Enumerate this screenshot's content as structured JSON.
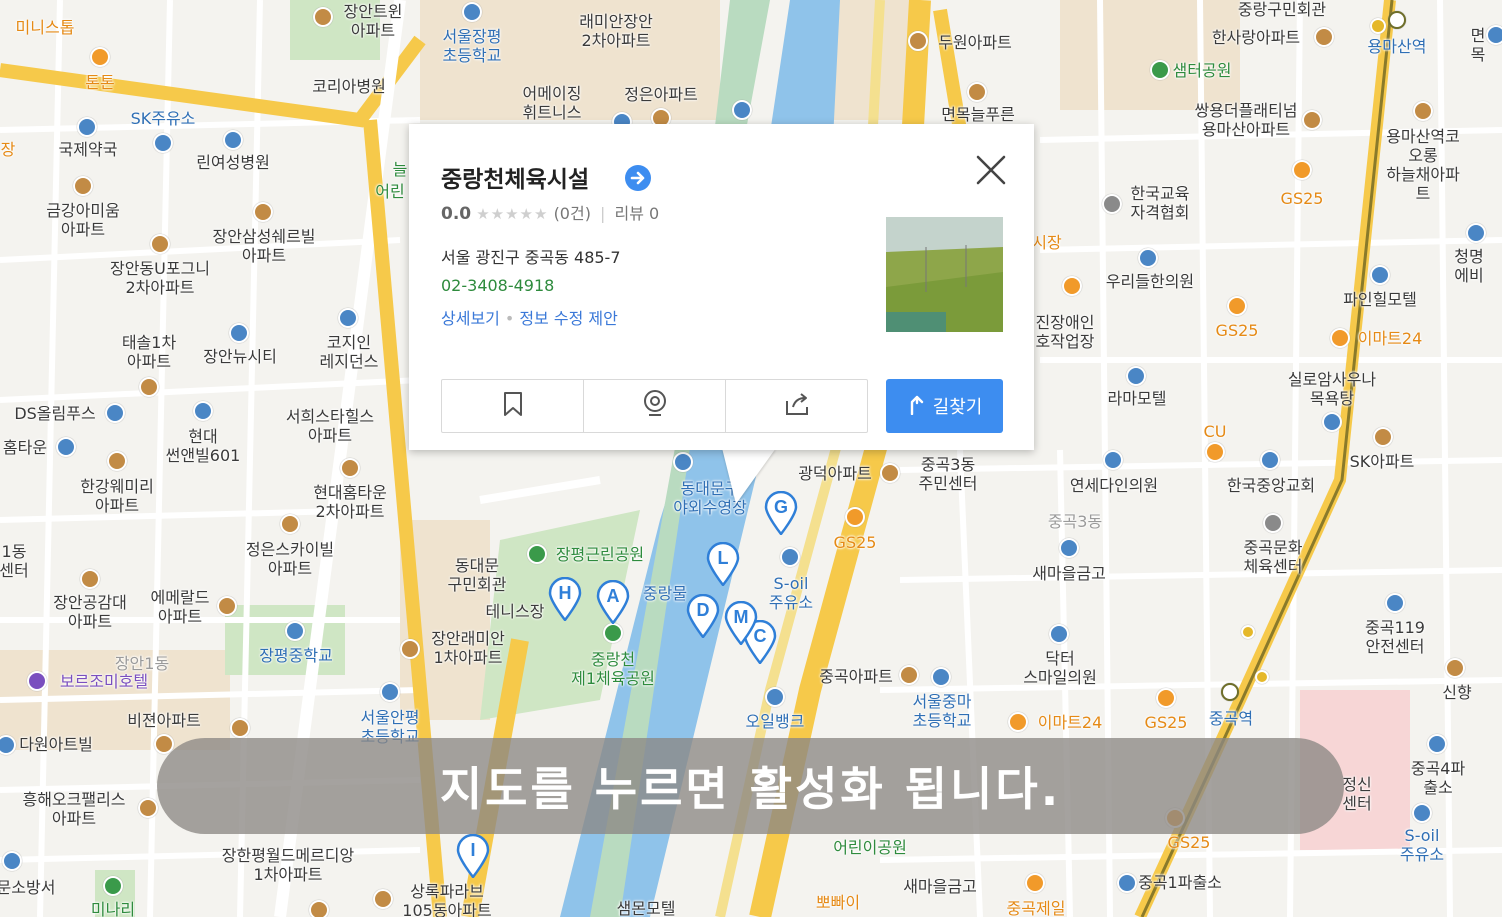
{
  "popup": {
    "place_name": "중랑천체육시설",
    "rating_score": "0.0",
    "stars": "★★★★★",
    "review_count": "(0건)",
    "review_label": "리뷰 0",
    "address": "서울 광진구 중곡동 485-7",
    "phone": "02-3408-4918",
    "detail_link": "상세보기",
    "edit_link": "정보 수정 제안",
    "route_button": "길찾기",
    "actions": [
      "bookmark-icon",
      "location-pin-icon",
      "share-icon"
    ]
  },
  "toast": {
    "message": "지도를 누르면 활성화 됩니다."
  },
  "markers": [
    "A",
    "C",
    "D",
    "G",
    "H",
    "I",
    "L",
    "M"
  ],
  "colors": {
    "accent": "#3d8df0",
    "phone": "#2e8b3d",
    "link": "#3a78d8",
    "road_major": "#f6c94a",
    "water": "#8fc3ea",
    "park": "#cfe6c4"
  },
  "map_labels": {
    "l1": "미니스톱",
    "l2": "장안트윈\n아파트",
    "l3": "서울장평\n초등학교",
    "l4": "래미안장안\n2차아파트",
    "l5": "두원아파트",
    "l6": "중랑구민회관",
    "l7": "한사랑아파트",
    "l8": "면목",
    "l9": "용마산역",
    "l10": "톤톤",
    "l11": "코리아병원",
    "l12": "샘터공원",
    "l13": "SK주유소",
    "l14": "어메이징\n휘트니스",
    "l15": "정은아파트",
    "l16": "면목늘푸른",
    "l17": "쌍용더플래티넘\n용마산아파트",
    "l18": "용마산역코오롱\n하늘채아파트",
    "l19": "국제약국",
    "l20": "린여성병원",
    "l21": "한국교육\n자격협회",
    "l22": "GS25",
    "l23": "금강아미움\n아파트",
    "l24": "장안삼성쉐르빌\n아파트",
    "l25": "우리들한의원",
    "l26": "청명에비",
    "l27": "장안동U포그니\n2차아파트",
    "l28": "시장",
    "l29": "파인힐모텔",
    "l30": "태솔1차\n아파트",
    "l31": "코지인\n레지던스",
    "l32": "장안뉴시티",
    "l33": "진장애인\n호작업장",
    "l34": "GS25",
    "l35": "이마트24",
    "l36": "라마모텔",
    "l37": "실로암사우나\n목욕탕",
    "l38": "DS올림푸스",
    "l39": "서희스타힐스\n아파트",
    "l40": "현대\n썬앤빌601",
    "l41": "홈타운",
    "l42": "CU",
    "l43": "SK아파트",
    "l44": "광덕아파트",
    "l45": "중곡3동\n주민센터",
    "l46": "연세다인의원",
    "l47": "한국중앙교회",
    "l48": "한강웨미리\n아파트",
    "l49": "현대홈타운\n2차아파트",
    "l50": "동대문구\n야외수영장",
    "l51": "GS25",
    "l52": "중곡3동",
    "l53": "정은스카이빌\n아파트",
    "l54": "동대문\n구민회관",
    "l55": "장평근린공원",
    "l56": "S-oil\n주유소",
    "l57": "새마을금고",
    "l58": "중곡문화\n체육센터",
    "l59": "1동\n센터",
    "l60": "장안공감대\n아파트",
    "l61": "에메랄드\n아파트",
    "l62": "테니스장",
    "l63": "장안래미안\n1차아파트",
    "l64": "중랑천\n제1체육공원",
    "l65": "닥터\n스마일의원",
    "l66": "중곡119\n안전센터",
    "l67": "장평중학교",
    "l68": "장안1동",
    "l69": "보르조미호텔",
    "l70": "중곡아파트",
    "l71": "신향",
    "l72": "서울안평\n초등학교",
    "l73": "서울중마\n초등학교",
    "l74": "이마트24",
    "l75": "GS25",
    "l76": "중곡역",
    "l77": "비젼아파트",
    "l78": "오일뱅크",
    "l79": "다원아트빌",
    "l80": "중곡4파출소",
    "l81": "흥해오크팰리스\n아파트",
    "l82": "정신\n센터",
    "l83": "S-oil\n주유소",
    "l84": "장한평월드메르디앙\n1차아파트",
    "l85": "어린이공원",
    "l86": "GS25",
    "l87": "상록파라브\n105동아파트",
    "l88": "문소방서",
    "l89": "미나리",
    "l90": "샘몬모텔",
    "l91": "뽀빠이",
    "l92": "새마을금고",
    "l93": "중곡1파출소",
    "l94": "중곡제일",
    "l95": "늘",
    "l96": "어린",
    "l97": "중랑물",
    "l98": "장"
  }
}
